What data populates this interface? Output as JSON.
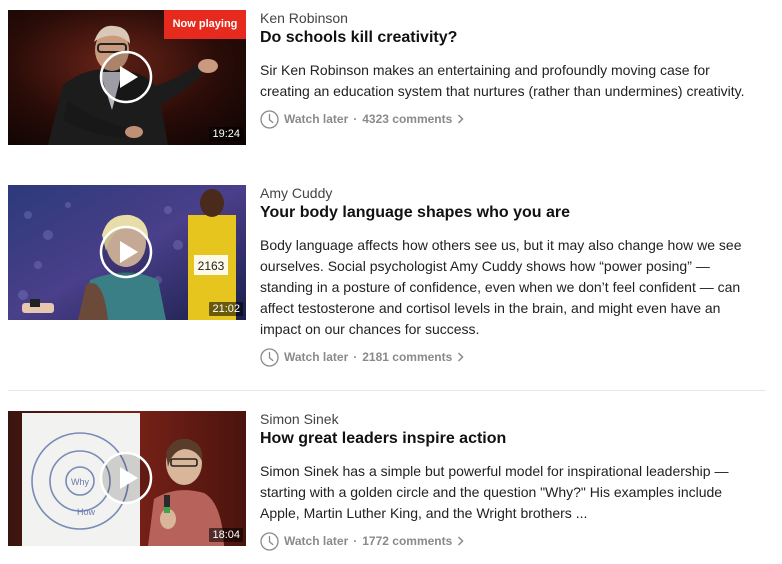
{
  "talks": [
    {
      "speaker": "Ken Robinson",
      "title": "Do schools kill creativity?",
      "description": "Sir Ken Robinson makes an entertaining and profoundly moving case for creating an education system that nurtures (rather than undermines) creativity.",
      "duration": "19:24",
      "badge": "Now playing",
      "watch_later": "Watch later",
      "separator": "·",
      "comments": "4323 comments"
    },
    {
      "speaker": "Amy Cuddy",
      "title": "Your body language shapes who you are",
      "description": "Body language affects how others see us, but it may also change how we see ourselves. Social psychologist Amy Cuddy shows how “power posing” — standing in a posture of confidence, even when we don’t feel confident — can affect testosterone and cortisol levels in the brain, and might even have an impact on our chances for success.",
      "duration": "21:02",
      "watch_later": "Watch later",
      "separator": "·",
      "comments": "2181 comments"
    },
    {
      "speaker": "Simon Sinek",
      "title": "How great leaders inspire action",
      "description": "Simon Sinek has a simple but powerful model for inspirational leadership — starting with a golden circle and the question \"Why?\" His examples include Apple, Martin Luther King, and the Wright brothers ...",
      "duration": "18:04",
      "watch_later": "Watch later",
      "separator": "·",
      "comments": "1772 comments"
    }
  ],
  "colors": {
    "badge": "#e62b1e",
    "meta_text": "#8a8a8a",
    "divider": "#e6e6e6"
  },
  "icons": {
    "play": "play-circle-icon",
    "clock": "clock-icon",
    "chevron": "chevron-right-icon"
  }
}
